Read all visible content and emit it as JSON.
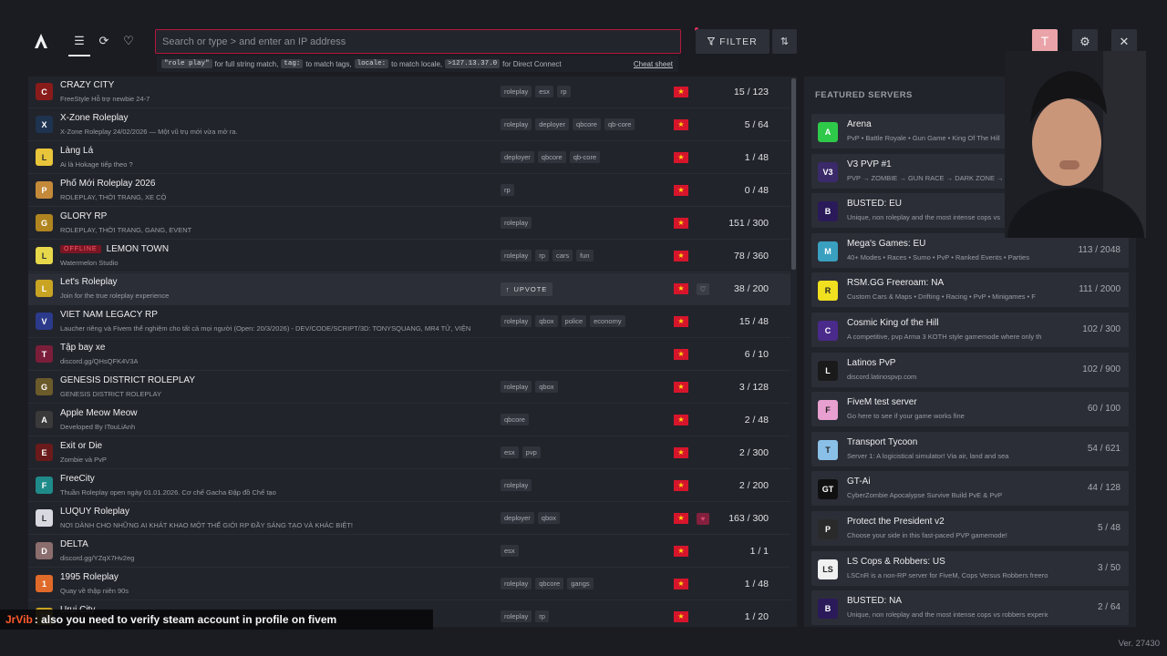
{
  "nav": {
    "logo_icon": "altv-logo-icon",
    "items": [
      {
        "icon": "list-icon",
        "glyph": "☰"
      },
      {
        "icon": "history-icon",
        "glyph": "⟳"
      },
      {
        "icon": "heart-icon",
        "glyph": "♡"
      }
    ]
  },
  "search": {
    "placeholder": "Search or type > and enter an IP address",
    "hints": {
      "code1": "\"role play\"",
      "text1": "for full string match,",
      "code2": "tag:",
      "text2": "to match tags,",
      "code3": "locale:",
      "text3": "to match locale,",
      "code4": ">127.13.37.0",
      "text4": "for Direct Connect",
      "cheat": "Cheat sheet"
    }
  },
  "toolbar": {
    "filter_label": "FILTER",
    "sort_icon": "sort-icon"
  },
  "account": {
    "avatar_letter": "T"
  },
  "servers": [
    {
      "name": "CRAZY CITY",
      "desc": "FreeStyle Hỗ trợ newbie 24-7",
      "tags": [
        "roleplay",
        "esx",
        "rp"
      ],
      "players": "15 / 123",
      "color": "#8a1b1b"
    },
    {
      "name": "X-Zone Roleplay",
      "desc": "X-Zone Roleplay 24/02/2026 — Một vũ trụ mới vừa mở ra.",
      "tags": [
        "roleplay",
        "deployer",
        "qbcore",
        "qb-core"
      ],
      "players": "5 / 64",
      "color": "#1e3350"
    },
    {
      "name": "Làng Lá",
      "desc": "Ai là Hokage tiếp theo ?",
      "tags": [
        "deployer",
        "qbcore",
        "qb-core"
      ],
      "players": "1 / 48",
      "color": "#e8c53a"
    },
    {
      "name": "Phố Mới Roleplay 2026",
      "desc": "ROLEPLAY, THỜI TRANG, XE CỘ",
      "tags": [
        "rp"
      ],
      "players": "0 / 48",
      "color": "#c48a3a"
    },
    {
      "name": "GLORY RP",
      "desc": "ROLEPLAY, THỜI TRANG, GANG, EVENT",
      "tags": [
        "roleplay"
      ],
      "players": "151 / 300",
      "color": "#b08520"
    },
    {
      "name": "LEMON TOWN",
      "offline": "OFFLINE",
      "desc": "Watermelon Studio",
      "tags": [
        "roleplay",
        "rp",
        "cars",
        "fun"
      ],
      "players": "78 / 360",
      "color": "#e6d84a"
    },
    {
      "name": "Let's Roleplay",
      "desc": "Join for the true roleplay experience",
      "upvote": "UPVOTE",
      "players": "38 / 200",
      "color": "#c9a423",
      "heart": true
    },
    {
      "name": "VIET NAM LEGACY RP",
      "desc": "Laucher riêng và Fivem thể nghiệm cho tất cả mọi người (Open: 20/3/2026) - DEV/CODE/SCRIPT/3D: TONYSQUANG, MR4 TỬ, VIỆN",
      "tags": [
        "roleplay",
        "qbox",
        "police",
        "economy"
      ],
      "players": "15 / 48",
      "color": "#2b3a8a"
    },
    {
      "name": "Tập bay xe",
      "desc": "discord.gg/QHsQFK4V3A",
      "tags": [],
      "players": "6 / 10",
      "color": "#7a1e3a"
    },
    {
      "name": "GENESIS DISTRICT ROLEPLAY",
      "desc": "GENESIS DISTRICT ROLEPLAY",
      "tags": [
        "roleplay",
        "qbox"
      ],
      "players": "3 / 128",
      "color": "#6b5a2a"
    },
    {
      "name": "Apple Meow Meow",
      "desc": "Developed By ITouLiAnh",
      "tags": [
        "qbcore"
      ],
      "players": "2 / 48",
      "color": "#3a3a3a"
    },
    {
      "name": "Exit or Die",
      "desc": "Zombie và PvP",
      "tags": [
        "esx",
        "pvp"
      ],
      "players": "2 / 300",
      "color": "#6a1a1a"
    },
    {
      "name": "FreeCity",
      "desc": "Thuần Roleplay open ngày 01.01.2026. Cơ chế Gacha Đập đồ Chế tạo",
      "tags": [
        "roleplay"
      ],
      "players": "2 / 200",
      "color": "#1f8a8a"
    },
    {
      "name": "LUQUY Roleplay",
      "desc": "NƠI DÀNH CHO NHỮNG AI KHÁT KHAO MỘT THẾ GIỚI RP ĐẦY SÁNG TẠO VÀ KHÁC BIỆT!",
      "tags": [
        "deployer",
        "qbox"
      ],
      "players": "163 / 300",
      "color": "#d8d8e0",
      "heart_pink": true
    },
    {
      "name": "DELTA",
      "desc": "discord.gg/YZqX7Hv2eg",
      "tags": [
        "esx"
      ],
      "players": "1 / 1",
      "color": "#8a6d6d"
    },
    {
      "name": "1995 Roleplay",
      "desc": "Quay về thập niên 90s",
      "tags": [
        "roleplay",
        "qbcore",
        "gangs"
      ],
      "players": "1 / 48",
      "color": "#e06a2a"
    },
    {
      "name": "Urui City",
      "desc": "",
      "tags": [
        "roleplay",
        "rp"
      ],
      "players": "1 / 20",
      "color": "#c9a423"
    }
  ],
  "featured": {
    "title": "FEATURED SERVERS",
    "items": [
      {
        "name": "Arena",
        "desc": "PvP • Battle Royale • Gun Game • King Of The Hill",
        "players": "",
        "color": "#2fc94a",
        "glyph": "A"
      },
      {
        "name": "V3 PVP #1",
        "desc": "PVP → ZOMBIE → GUN RACE → DARK ZONE → R",
        "players": "",
        "color": "#3a2a6a",
        "glyph": "V3"
      },
      {
        "name": "BUSTED: EU",
        "desc": "Unique, non roleplay and the most intense cops vs",
        "players": "",
        "color": "#2a1a5a",
        "glyph": "B"
      },
      {
        "name": "Mega's Games: EU",
        "desc": "40+ Modes • Races • Sumo • PvP • Ranked Events • Parties",
        "players": "113 / 2048",
        "color": "#3aa0c0",
        "glyph": "M"
      },
      {
        "name": "RSM.GG Freeroam: NA",
        "desc": "Custom Cars & Maps • Drifting • Racing • PvP • Minigames • F",
        "players": "111 / 2000",
        "color": "#f0e020",
        "glyph": "R"
      },
      {
        "name": "Cosmic King of the Hill",
        "desc": "A competitive, pvp Arma 3 KOTH style gamemode where only th",
        "players": "102 / 300",
        "color": "#4a2a8a",
        "glyph": "C"
      },
      {
        "name": "Latinos PvP",
        "desc": "discord.latinospvp.com",
        "players": "102 / 900",
        "color": "#1a1a1a",
        "glyph": "L"
      },
      {
        "name": "FiveM test server",
        "desc": "Go here to see if your game works fine",
        "players": "60 / 100",
        "color": "#e8a0d0",
        "glyph": "F"
      },
      {
        "name": "Transport Tycoon",
        "desc": "Server 1: A logicistical simulator! Via air, land and sea",
        "players": "54 / 621",
        "color": "#8ac0e8",
        "glyph": "T"
      },
      {
        "name": "GT-Ai",
        "desc": "CyberZombie Apocalypse Survive Build PvE & PvP",
        "players": "44 / 128",
        "color": "#101010",
        "glyph": "GT"
      },
      {
        "name": "Protect the President v2",
        "desc": "Choose your side in this fast-paced PVP gamemode!",
        "players": "5 / 48",
        "color": "#2a2a2a",
        "glyph": "P"
      },
      {
        "name": "LS Cops & Robbers: US",
        "desc": "LSCnR is a non-RP server for FiveM, Cops Versus Robbers freeroam",
        "players": "3 / 50",
        "color": "#f0f0f0",
        "glyph": "LS"
      },
      {
        "name": "BUSTED: NA",
        "desc": "Unique, non roleplay and the most intense cops vs robbers experience",
        "players": "2 / 64",
        "color": "#2a1a5a",
        "glyph": "B"
      }
    ]
  },
  "version": "Ver. 27430",
  "chat": {
    "user": "JrVib",
    "message": ": also you need to verify steam account in profile on fivem"
  }
}
